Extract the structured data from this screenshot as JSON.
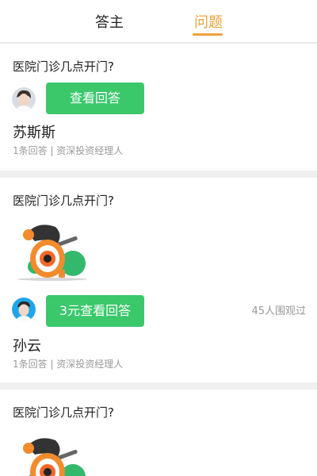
{
  "tabs": [
    {
      "label": "答主",
      "active": false
    },
    {
      "label": "问题",
      "active": true
    }
  ],
  "accent_color": "#f0a23a",
  "button_color": "#3ac86b",
  "cards": [
    {
      "question": "医院门诊几点开门?",
      "button_label": "查看回答",
      "answerer_name": "苏斯斯",
      "meta": "1条回答 | 资深投资经理人"
    },
    {
      "question": "医院门诊几点开门?",
      "button_label": "3元查看回答",
      "views": "45人围观过",
      "answerer_name": "孙云",
      "meta": "1条回答 | 资深投资经理人"
    },
    {
      "question": "医院门诊几点开门?"
    }
  ]
}
